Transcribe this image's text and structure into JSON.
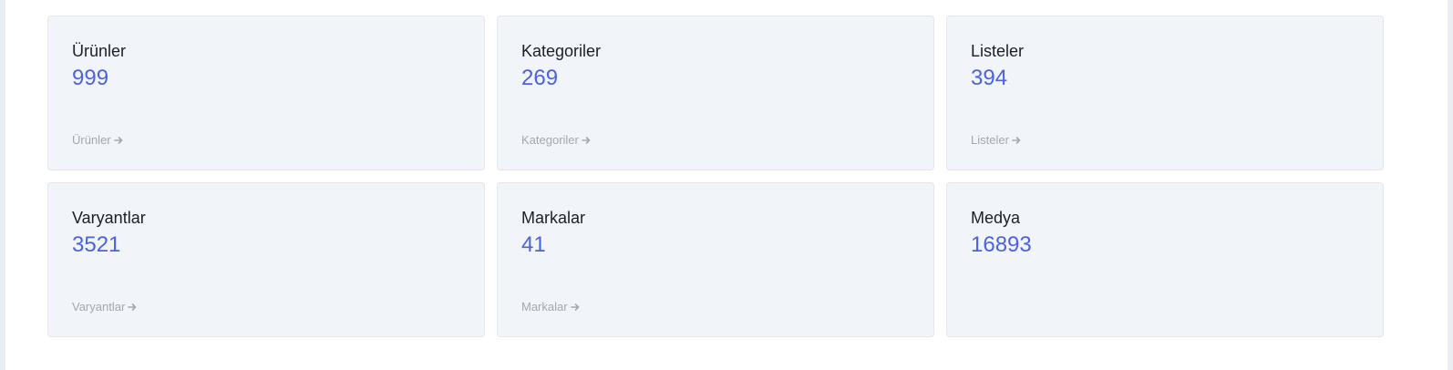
{
  "colors": {
    "accent": "#4b63e0",
    "card_bg": "#f1f4f8",
    "link": "#a2a8b2"
  },
  "cards": [
    {
      "title": "Ürünler",
      "count": "999",
      "link": "Ürünler"
    },
    {
      "title": "Kategoriler",
      "count": "269",
      "link": "Kategoriler"
    },
    {
      "title": "Listeler",
      "count": "394",
      "link": "Listeler"
    },
    {
      "title": "Varyantlar",
      "count": "3521",
      "link": "Varyantlar"
    },
    {
      "title": "Markalar",
      "count": "41",
      "link": "Markalar"
    },
    {
      "title": "Medya",
      "count": "16893",
      "link": null
    }
  ]
}
